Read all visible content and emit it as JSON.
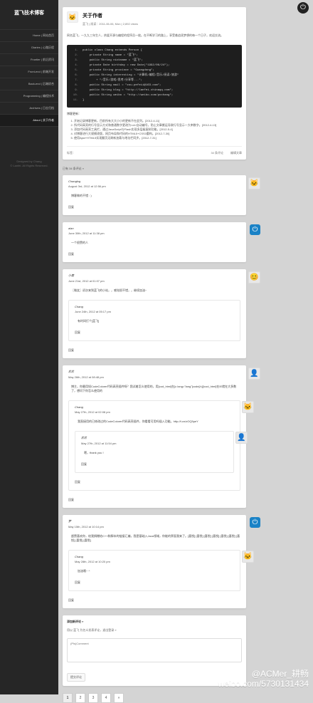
{
  "sidebar": {
    "site_title": "蓝飞技术博客",
    "nav": [
      {
        "label": "Home | 网站首页",
        "active": false
      },
      {
        "label": "Diaries | 心路历程",
        "active": false
      },
      {
        "label": "Frontier | 前沿资讯",
        "active": false
      },
      {
        "label": "Front-end | 前端开发",
        "active": false
      },
      {
        "label": "Back-end | 后端综合",
        "active": false
      },
      {
        "label": "Programming | 编程技术",
        "active": false
      },
      {
        "label": "Archives | 日志归档",
        "active": false
      },
      {
        "label": "About | 关于作者",
        "active": true
      }
    ],
    "designed_line1": "Designed by Chang",
    "designed_line2": "© Lanfei. All Rights Reserved."
  },
  "top_right_icon": "power-icon",
  "post": {
    "title": "关于作者",
    "meta": "蓝飞 | 阅读：2011-06-06, Mon | 2,892 views",
    "intro": "网名蓝飞，一九九三年生人，热爱开源与编程的程序员一枚。在不断学习的路上，享受着追逐梦想的每一个日子，欢迎交流。",
    "code_lines": [
      "public class Chang extends Person {",
      "    private String name = \"蓝飞\";",
      "    public String nickname = \"蓝飞\";",
      "    private Date birthday = new Date(\"1992/06/24\");",
      "    private String province = \"Guangdong\";",
      "    public String interesting = \"计算机/编程/音乐/阅读/旅游\"",
      "        + \"/音乐/游戏/思考/分享等...\";",
      "    public String mail = \"zou.pefeii@163.com\";",
      "    public String blog = \"http://lanfei.chinaqq.com\";",
      "    public String weibo = \"http://weibo.com/pcchang\";",
      "}"
    ],
    "updates_title": "博客更新：",
    "updates": [
      "开始记录博客更新，目前所有大大小小的更新不在此列。[2012-4-11]",
      "所代码高亮的行号显示方式和普通数字更改为<ol>自动编号，防止文章搬运导致行号显示一大串数字。[2012-4-13]",
      "添加代码高亮工具栏，通过JavaScript与Flash实现多层级复制功能。[2012-5-4]",
      "对博客进行大规模改版，网页布局和代码的HTML5+CSS3重构。[2012-7-30]",
      "使用Ajax+HTML5实现翻页无刷新加载与地址栏同步。[2012-7-31]"
    ],
    "footer_left": "标签：",
    "footer_comments": "34 条评论",
    "footer_edit": "编辑文章"
  },
  "comments_header": "已有 34 条评论 »",
  "comments": [
    {
      "author": "Changlog",
      "date": "August 3rd, 2012 at 12:56 pm",
      "body": "博客做的不错 : )",
      "reply": "回复",
      "avatar": "cat-icon"
    },
    {
      "author": "alan",
      "date": "June 30th, 2012 at 11:38 pm",
      "body": "一个很赞的人",
      "reply": "回复",
      "avatar": "power-icon"
    },
    {
      "author": "小鹿",
      "date": "June 21st, 2012 at 01:07 pm",
      "body": "〖微笑〗初次来到蓝飞的小站，，感觉很不错，，继续加油~",
      "reply": "回复",
      "avatar": "smiley-icon",
      "nested": {
        "author": "Chang",
        "date": "June 24th, 2012 at 05:17 pm",
        "body": "有时间打个[蓝飞]",
        "reply": "回复",
        "avatar": "none-icon"
      }
    },
    {
      "author": "尼尼",
      "date": "May 26th, 2012 at 08:48 pm",
      "body": "博主，你最用如CodeColorer代码高亮插件呀？我试着怎么使用的，用[cod_html]在[c lang=\"lang\"]code[/c][/cod_html]在IE就在大多数了，想问下你怎么使用的",
      "reply": "回复",
      "avatar": "user-icon",
      "nested": {
        "author": "Chang",
        "date": "May 27th, 2012 at 02:08 pm",
        "body": "我直接用的已修改过的CodeColorer代码高亮插件，你看看可用吗插入功能。http://t.cn/zOQ5peY",
        "reply": "回复",
        "avatar": "cat-icon",
        "nested": {
          "author": "尼尼",
          "date": "May 27th, 2012 at 11:54 pm",
          "body": "嗯，thank you !",
          "reply": "回复",
          "avatar": "user-icon"
        }
      }
    },
    {
      "author": "梦",
      "date": "May 15th, 2012 at 10:14 pm",
      "body": "超赞喜欢你，给我捐赠给C++和脚本的链接汇编，我是基础入Java领域，你能的界面我来了。[喜悦] [喜悦] [喜悦] [喜悦] [喜悦] [喜悦] [喜悦] [喜悦] [喜悦]",
      "reply": "回复",
      "avatar": "power-icon",
      "nested": {
        "author": "Chang",
        "date": "May 28th, 2012 at 10:20 pm",
        "body": "加油哦~ ^",
        "reply": "回复",
        "avatar": "cat-icon"
      }
    }
  ],
  "reply_form": {
    "title": "添加新评论 »",
    "info": "用以 蓝飞 为名义发表评论，退出登录 »",
    "textarea_placeholder": "(Pls)Comment",
    "submit": "提交评论"
  },
  "pagination": [
    "1",
    "2",
    "3",
    "4",
    "»"
  ],
  "watermark": {
    "line1": "@ACMer_耕畅",
    "line2": "weibo.com/5730131434"
  }
}
